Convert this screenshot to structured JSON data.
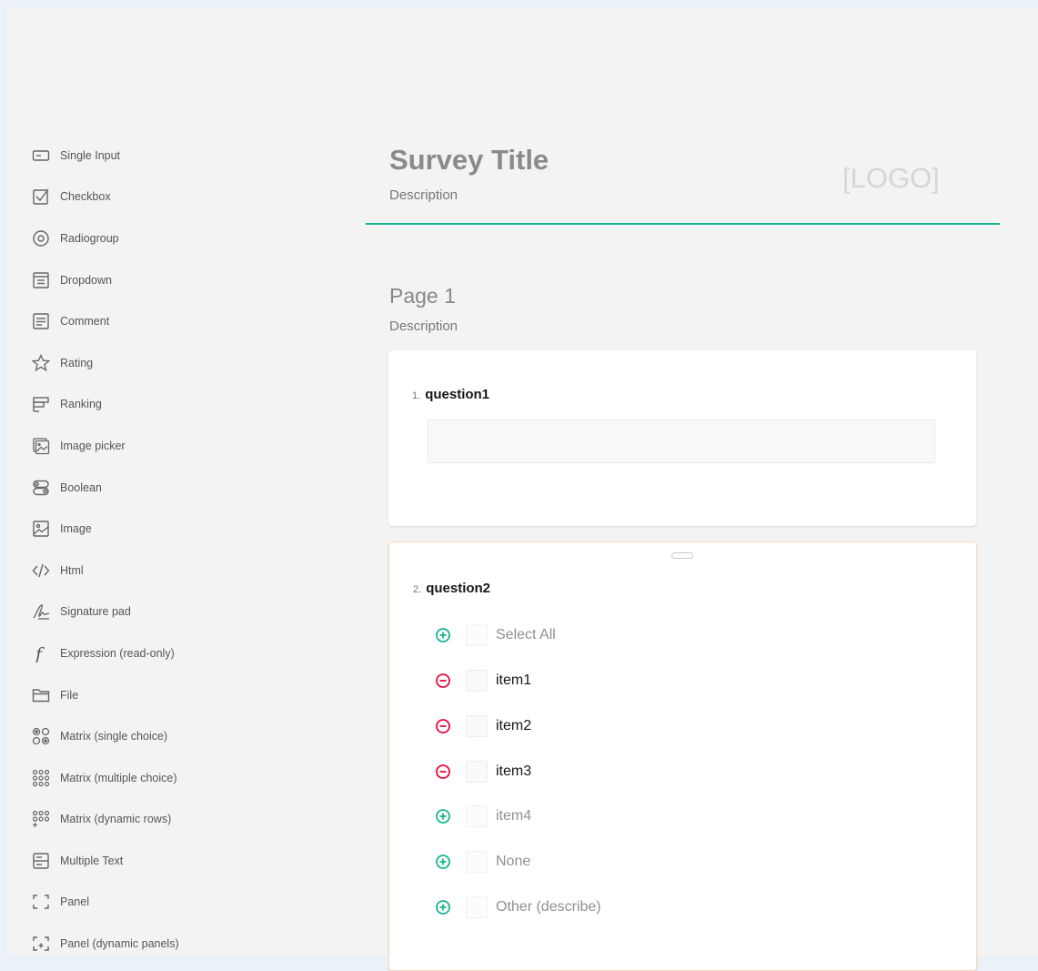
{
  "toolbox": {
    "items": [
      {
        "label": "Single Input",
        "icon": "single-input-icon"
      },
      {
        "label": "Checkbox",
        "icon": "checkbox-icon"
      },
      {
        "label": "Radiogroup",
        "icon": "radiogroup-icon"
      },
      {
        "label": "Dropdown",
        "icon": "dropdown-icon"
      },
      {
        "label": "Comment",
        "icon": "comment-icon"
      },
      {
        "label": "Rating",
        "icon": "star-icon"
      },
      {
        "label": "Ranking",
        "icon": "ranking-icon"
      },
      {
        "label": "Image picker",
        "icon": "image-picker-icon"
      },
      {
        "label": "Boolean",
        "icon": "boolean-icon"
      },
      {
        "label": "Image",
        "icon": "image-icon"
      },
      {
        "label": "Html",
        "icon": "html-icon"
      },
      {
        "label": "Signature pad",
        "icon": "signature-icon"
      },
      {
        "label": "Expression (read-only)",
        "icon": "expression-icon"
      },
      {
        "label": "File",
        "icon": "folder-icon"
      },
      {
        "label": "Matrix (single choice)",
        "icon": "matrix-single-icon"
      },
      {
        "label": "Matrix (multiple choice)",
        "icon": "matrix-multiple-icon"
      },
      {
        "label": "Matrix (dynamic rows)",
        "icon": "matrix-dynamic-icon"
      },
      {
        "label": "Multiple Text",
        "icon": "multiple-text-icon"
      },
      {
        "label": "Panel",
        "icon": "panel-icon"
      },
      {
        "label": "Panel (dynamic panels)",
        "icon": "panel-dynamic-icon"
      }
    ]
  },
  "survey": {
    "title": "Survey Title",
    "description": "Description",
    "logo": "[LOGO]"
  },
  "page": {
    "title": "Page 1",
    "description": "Description"
  },
  "questions": [
    {
      "number": "1.",
      "title": "question1"
    },
    {
      "number": "2.",
      "title": "question2"
    }
  ],
  "choices": [
    {
      "label": "Select All",
      "action": "add",
      "state": "inactive"
    },
    {
      "label": "item1",
      "action": "remove",
      "state": "active"
    },
    {
      "label": "item2",
      "action": "remove",
      "state": "active"
    },
    {
      "label": "item3",
      "action": "remove",
      "state": "active"
    },
    {
      "label": "item4",
      "action": "add",
      "state": "inactive"
    },
    {
      "label": "None",
      "action": "add",
      "state": "inactive"
    },
    {
      "label": "Other (describe)",
      "action": "add",
      "state": "inactive"
    }
  ],
  "colors": {
    "accent": "#19b394",
    "remove": "#e60a3e",
    "selected_border": "#fbd9bb"
  }
}
